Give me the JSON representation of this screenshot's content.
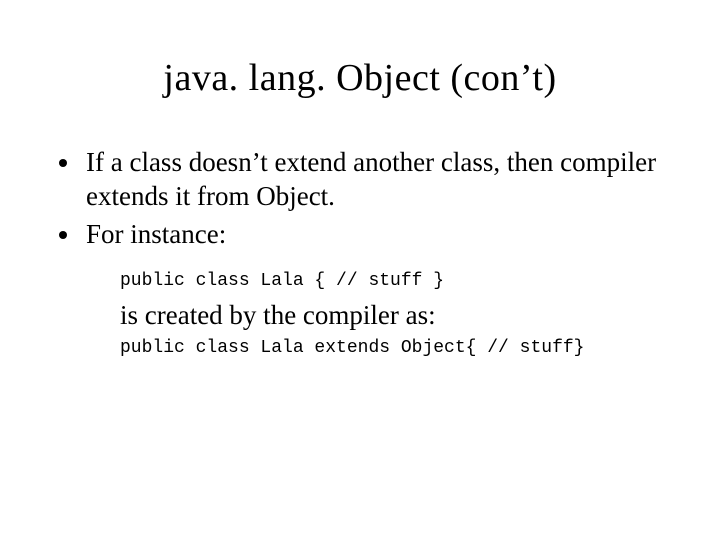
{
  "title": "java. lang. Object (con’t)",
  "bullets": [
    "If a class doesn’t extend another class, then compiler extends it from Object.",
    "For instance:"
  ],
  "code_before": "public class Lala { // stuff }",
  "explain": "is created by the compiler as:",
  "code_after": "public class Lala extends Object{ // stuff}"
}
